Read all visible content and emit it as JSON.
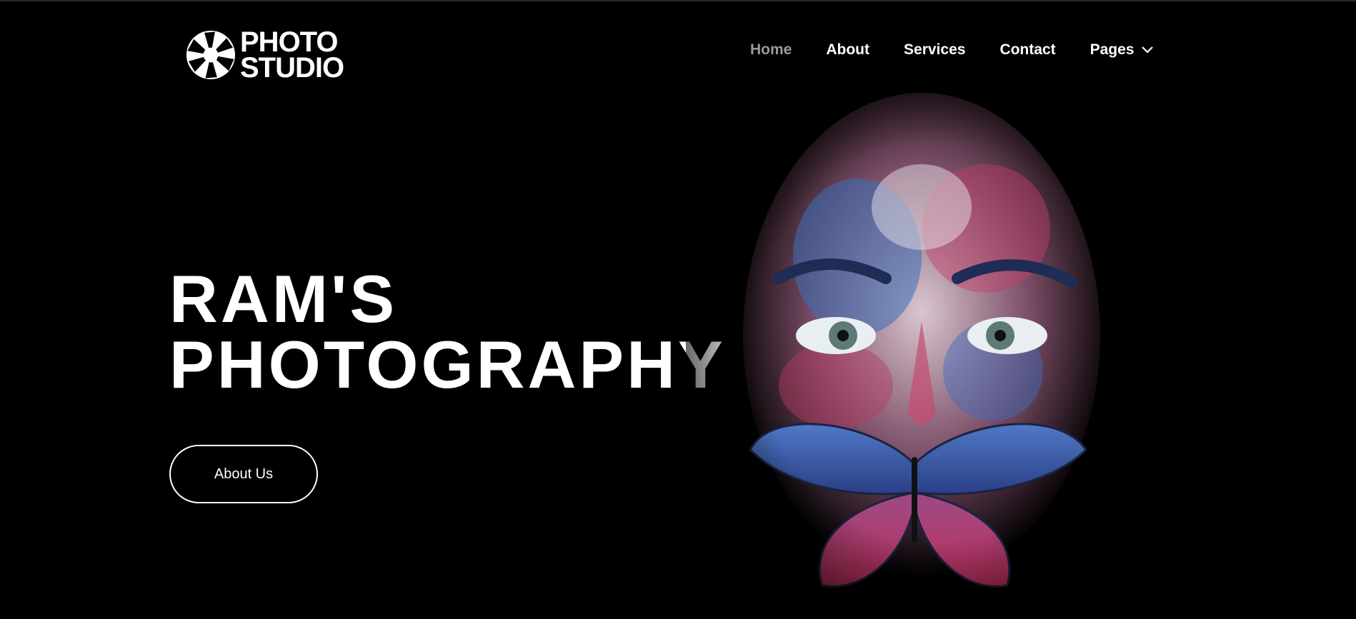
{
  "brand": {
    "name_line1": "PHOTO",
    "name_line2": "STUDIO",
    "icon": "camera-aperture-icon"
  },
  "nav": {
    "items": [
      {
        "label": "Home",
        "active": true
      },
      {
        "label": "About",
        "active": false
      },
      {
        "label": "Services",
        "active": false
      },
      {
        "label": "Contact",
        "active": false
      },
      {
        "label": "Pages",
        "active": false,
        "has_dropdown": true
      }
    ]
  },
  "hero": {
    "title_line1": "RAM'S",
    "title_line2": "PHOTOGRAPHY",
    "cta_label": "About Us"
  },
  "colors": {
    "background": "#000000",
    "text": "#ffffff",
    "nav_active": "#9a9a9a"
  }
}
